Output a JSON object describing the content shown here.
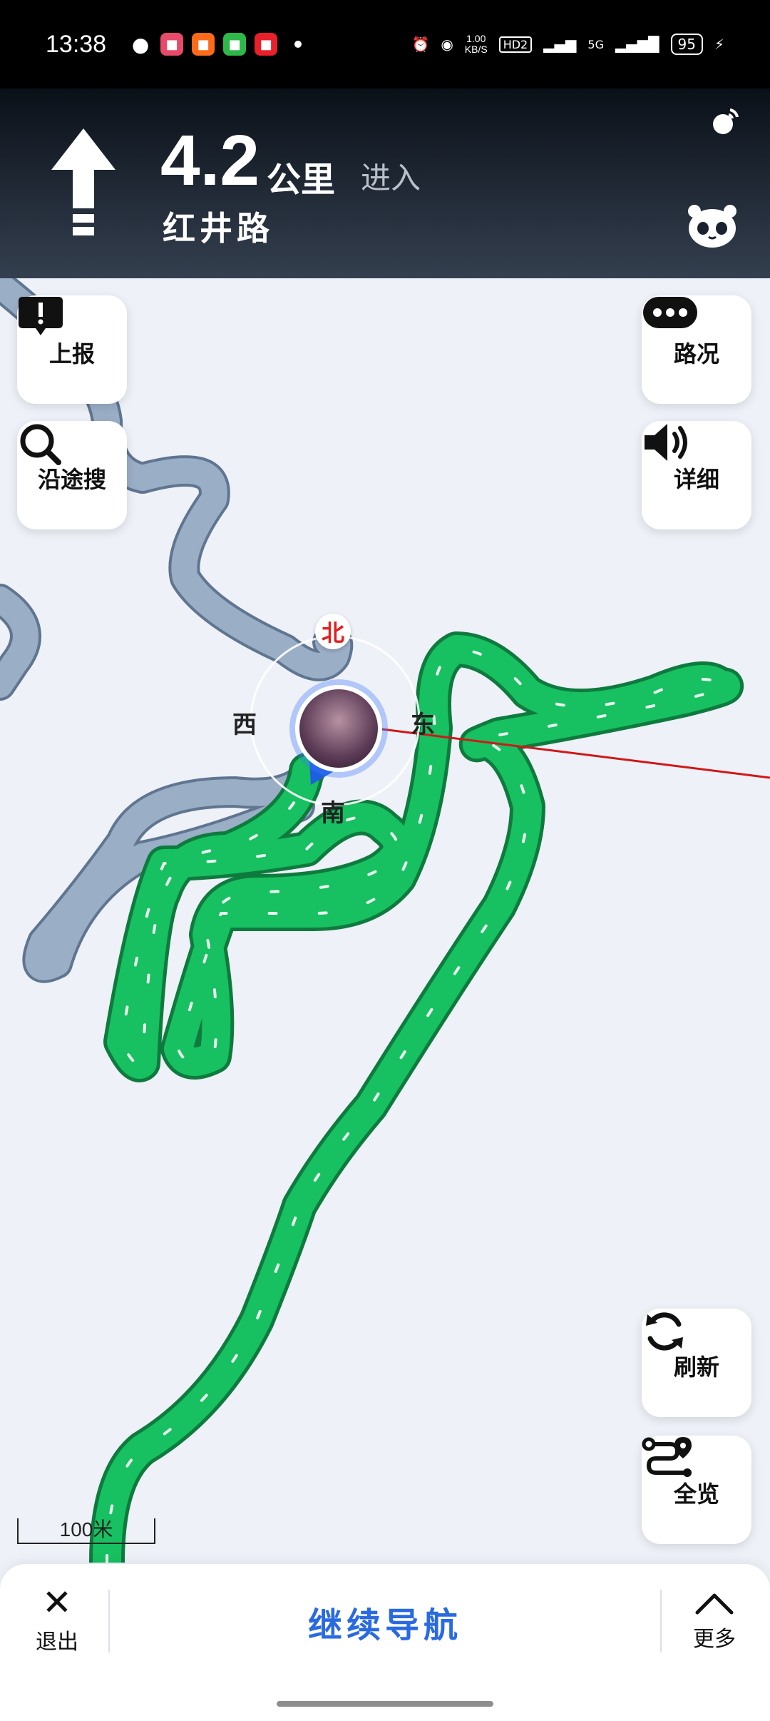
{
  "status_bar": {
    "time": "13:38",
    "network_speed": "1.00",
    "network_speed_unit": "KB/S",
    "hd_label": "HD2",
    "signal_label": "5G",
    "battery": "95",
    "notification_apps": [
      "wechat-icon",
      "app-icon-red",
      "app-icon-orange",
      "app-icon-green",
      "app-icon-red2"
    ]
  },
  "navigation": {
    "direction_icon": "straight-arrow-icon",
    "distance": "4.2",
    "distance_unit": "公里",
    "action": "进入",
    "road_name": "红井路"
  },
  "map": {
    "buttons_left": [
      {
        "label": "上报",
        "icon": "report-icon"
      },
      {
        "label": "沿途搜",
        "icon": "search-icon"
      }
    ],
    "buttons_right": [
      {
        "label": "路况",
        "icon": "traffic-icon"
      },
      {
        "label": "详细",
        "icon": "speaker-icon"
      },
      {
        "label": "刷新",
        "icon": "refresh-icon"
      },
      {
        "label": "全览",
        "icon": "overview-route-icon"
      }
    ],
    "compass": {
      "north": "北",
      "south": "南",
      "east": "东",
      "west": "西"
    },
    "scale": "100米",
    "colors": {
      "route": "#17c060",
      "route_edge": "#0f7a3e",
      "passed_road": "#9aaec6",
      "map_bg": "#eef1f8",
      "compass_north": "#e02020"
    }
  },
  "bottom_bar": {
    "exit_label": "退出",
    "continue_label": "继续导航",
    "more_label": "更多"
  }
}
